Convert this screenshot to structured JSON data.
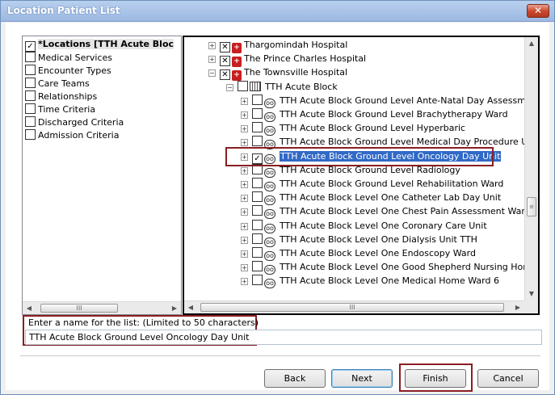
{
  "window": {
    "title": "Location Patient List",
    "close_glyph": "✕"
  },
  "criteria": {
    "items": [
      {
        "label": "*Locations [TTH Acute Bloc",
        "checked": true,
        "selected": true
      },
      {
        "label": "Medical Services",
        "checked": false
      },
      {
        "label": "Encounter Types",
        "checked": false
      },
      {
        "label": "Care Teams",
        "checked": false
      },
      {
        "label": "Relationships",
        "checked": false
      },
      {
        "label": "Time Criteria",
        "checked": false
      },
      {
        "label": "Discharged Criteria",
        "checked": false
      },
      {
        "label": "Admission Criteria",
        "checked": false
      }
    ]
  },
  "tree": {
    "hospitals": [
      {
        "label": "Thargomindah Hospital",
        "state": "partial",
        "expander": "+"
      },
      {
        "label": "The Prince Charles Hospital",
        "state": "partial",
        "expander": "+"
      },
      {
        "label": "The Townsville Hospital",
        "state": "partial",
        "expander": "−"
      }
    ],
    "building": {
      "label": "TTH Acute Block",
      "state": "unchecked",
      "expander": "−"
    },
    "wards": [
      {
        "label": "TTH Acute Block Ground Level Ante-Natal Day Assessment",
        "checked": false
      },
      {
        "label": "TTH Acute Block Ground Level Brachytherapy Ward",
        "checked": false
      },
      {
        "label": "TTH Acute Block Ground Level Hyperbaric",
        "checked": false
      },
      {
        "label": "TTH Acute Block Ground Level Medical Day Procedure Unit",
        "checked": false
      },
      {
        "label": "TTH Acute Block Ground Level Oncology Day Unit",
        "checked": true,
        "highlighted": true
      },
      {
        "label": "TTH Acute Block Ground Level Radiology",
        "checked": false
      },
      {
        "label": "TTH Acute Block Ground Level Rehabilitation Ward",
        "checked": false
      },
      {
        "label": "TTH Acute Block Level One Catheter Lab Day Unit",
        "checked": false
      },
      {
        "label": "TTH Acute Block Level One Chest Pain Assessment Ward",
        "checked": false
      },
      {
        "label": "TTH Acute Block Level One Coronary Care Unit",
        "checked": false
      },
      {
        "label": "TTH Acute Block Level One Dialysis Unit TTH",
        "checked": false
      },
      {
        "label": "TTH Acute Block Level One Endoscopy Ward",
        "checked": false
      },
      {
        "label": "TTH Acute Block Level One Good Shepherd Nursing Home",
        "checked": false
      },
      {
        "label": "TTH Acute Block Level One Medical Home Ward 6",
        "checked": false
      }
    ]
  },
  "name_field": {
    "label": "Enter a name for the list: (Limited to 50 characters)",
    "value": "TTH Acute Block Ground Level Oncology Day Unit"
  },
  "buttons": {
    "back": "Back",
    "next": "Next",
    "finish": "Finish",
    "cancel": "Cancel"
  },
  "scroll": {
    "thumb_glyph": "III",
    "left_arrow": "◀",
    "right_arrow": "▶",
    "up_arrow": "▲",
    "down_arrow": "▼"
  },
  "icons": {
    "checkbox_checked": "✓",
    "checkbox_partial": "✕",
    "hospital_icon": "hospital-icon",
    "building_icon": "building-icon",
    "ward_icon": "ward-icon"
  }
}
